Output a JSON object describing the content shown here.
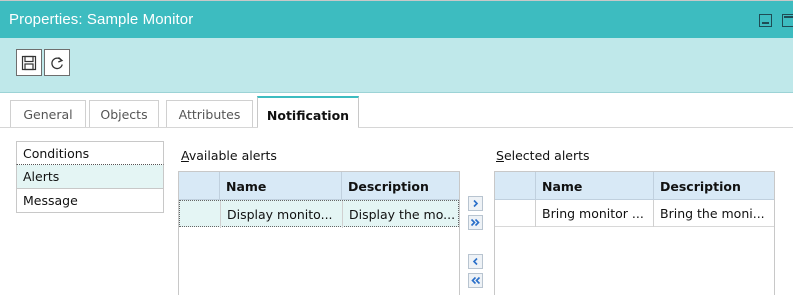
{
  "window": {
    "title": "Properties: Sample Monitor",
    "minimize_icon": "minimize-icon",
    "maximize_icon": "maximize-icon"
  },
  "toolbar": {
    "save_icon": "floppy-disk-icon",
    "refresh_icon": "refresh-icon"
  },
  "tabs": [
    {
      "label": "General",
      "active": false
    },
    {
      "label": "Objects",
      "active": false
    },
    {
      "label": "Attributes",
      "active": false
    },
    {
      "label": "Notification",
      "active": true
    }
  ],
  "side_nav": [
    {
      "label": "Conditions",
      "active": false
    },
    {
      "label": "Alerts",
      "active": true
    },
    {
      "label": "Message",
      "active": false
    }
  ],
  "available_alerts": {
    "label_accel": "A",
    "label_rest": "vailable alerts",
    "columns": [
      "Name",
      "Description"
    ],
    "rows": [
      {
        "name": "Display monito...",
        "description": "Display the mo..."
      }
    ]
  },
  "selected_alerts": {
    "label_accel": "S",
    "label_rest": "elected alerts",
    "columns": [
      "Name",
      "Description"
    ],
    "rows": [
      {
        "name": "Bring monitor ...",
        "description": "Bring the moni..."
      }
    ]
  },
  "move_buttons": {
    "move_one_right": ">",
    "move_all_right": "»",
    "move_one_left": "<",
    "move_all_left": "«"
  },
  "colors": {
    "title_bar": "#3dbcc0",
    "toolbar": "#bfe8ea",
    "grid_header": "#d8e9f6",
    "selected_row": "#e4f5f4",
    "arrow_blue": "#2a6fc9"
  }
}
